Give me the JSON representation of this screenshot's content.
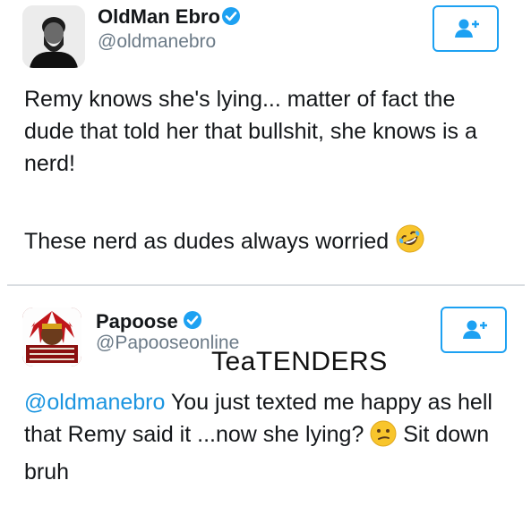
{
  "tweets": [
    {
      "name": "OldMan Ebro",
      "handle": "@oldmanebro",
      "paragraphs": [
        "Remy knows she's lying... matter of fact the dude that told her that bullshit, she knows is a nerd!",
        "These nerd as dudes always worried"
      ],
      "emoji": "rofl-emoji"
    },
    {
      "name": "Papoose",
      "handle": "@Papooseonline",
      "mention": "@oldmanebro",
      "text_before_emoji": " You just texted me happy as hell that Remy said it ...now she lying?",
      "text_after_emoji": " Sit down bruh",
      "emoji": "confused-emoji"
    }
  ],
  "watermark": "TeaTENDERS",
  "colors": {
    "accent": "#1da1f2",
    "mention": "#1b95e0",
    "handle": "#6b7a87",
    "divider": "#d9dde1"
  },
  "icons": {
    "verified": "verified-badge-icon",
    "follow": "add-user-icon"
  }
}
